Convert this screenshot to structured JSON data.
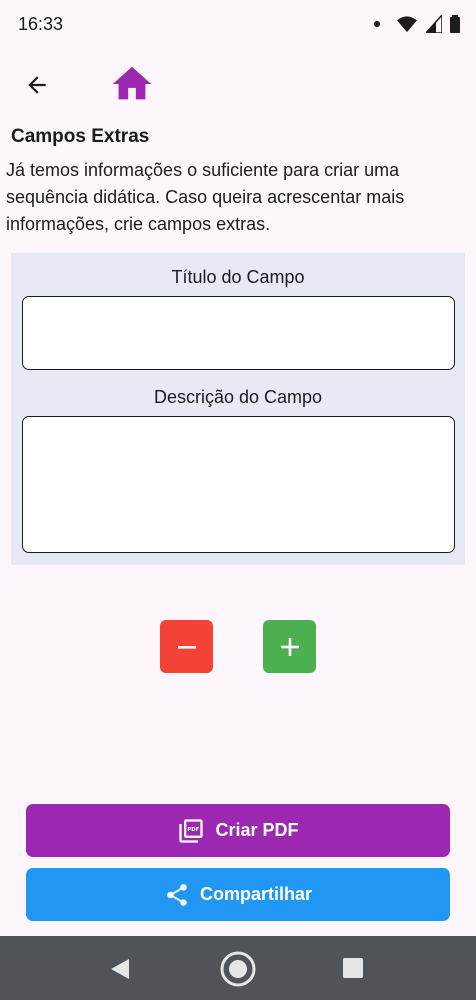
{
  "status": {
    "time": "16:33"
  },
  "icons": {
    "back": "arrow-back-icon",
    "home": "home-icon",
    "minus": "minus-icon",
    "plus": "plus-icon",
    "pdf": "pdf-icon",
    "share": "share-icon"
  },
  "section": {
    "title": "Campos Extras",
    "intro": "Já temos informações o suficiente para criar uma sequência didática. Caso queira acrescentar mais informações, crie campos extras."
  },
  "form": {
    "title_label": "Título do Campo",
    "title_value": "",
    "description_label": "Descrição do Campo",
    "description_value": ""
  },
  "actions": {
    "pdf_label": "Criar PDF",
    "share_label": "Compartilhar"
  },
  "colors": {
    "accent_purple": "#9c27b0",
    "remove_red": "#f44336",
    "add_green": "#4caf50",
    "share_blue": "#2196f3",
    "panel_bg": "#e7e9f4"
  }
}
